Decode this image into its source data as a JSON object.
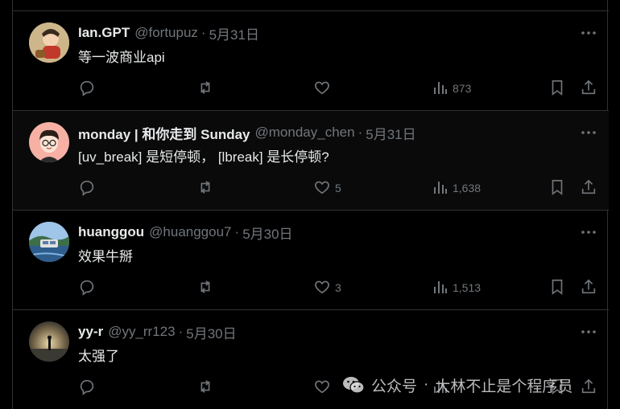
{
  "posts": [
    {
      "name": "Ian.GPT",
      "handle": "@fortupuz",
      "date": "5月31日",
      "text": "等一波商业api",
      "replies": "",
      "reposts": "",
      "likes": "",
      "views": "873",
      "avatar": "cartoon-avatar"
    },
    {
      "name": "monday | 和你走到 Sunday",
      "handle": "@monday_chen",
      "date": "5月31日",
      "text": "[uv_break] 是短停顿， [lbreak] 是长停顿?",
      "replies": "",
      "reposts": "",
      "likes": "5",
      "views": "1,638",
      "avatar": "glasses-boy-avatar"
    },
    {
      "name": "huanggou",
      "handle": "@huanggou7",
      "date": "5月30日",
      "text": "效果牛掰",
      "replies": "",
      "reposts": "",
      "likes": "3",
      "views": "1,513",
      "avatar": "landscape-avatar"
    },
    {
      "name": "yy-r",
      "handle": "@yy_rr123",
      "date": "5月30日",
      "text": "太强了",
      "replies": "",
      "reposts": "",
      "likes": "",
      "views": "",
      "avatar": "silhouette-avatar"
    }
  ],
  "watermark": {
    "account_type": "公众号",
    "separator": "·",
    "account_name": "大林不止是个程序员"
  },
  "colors": {
    "background": "#000000",
    "text_primary": "#e7e9ea",
    "text_secondary": "#71767b",
    "border": "#2f3336"
  }
}
